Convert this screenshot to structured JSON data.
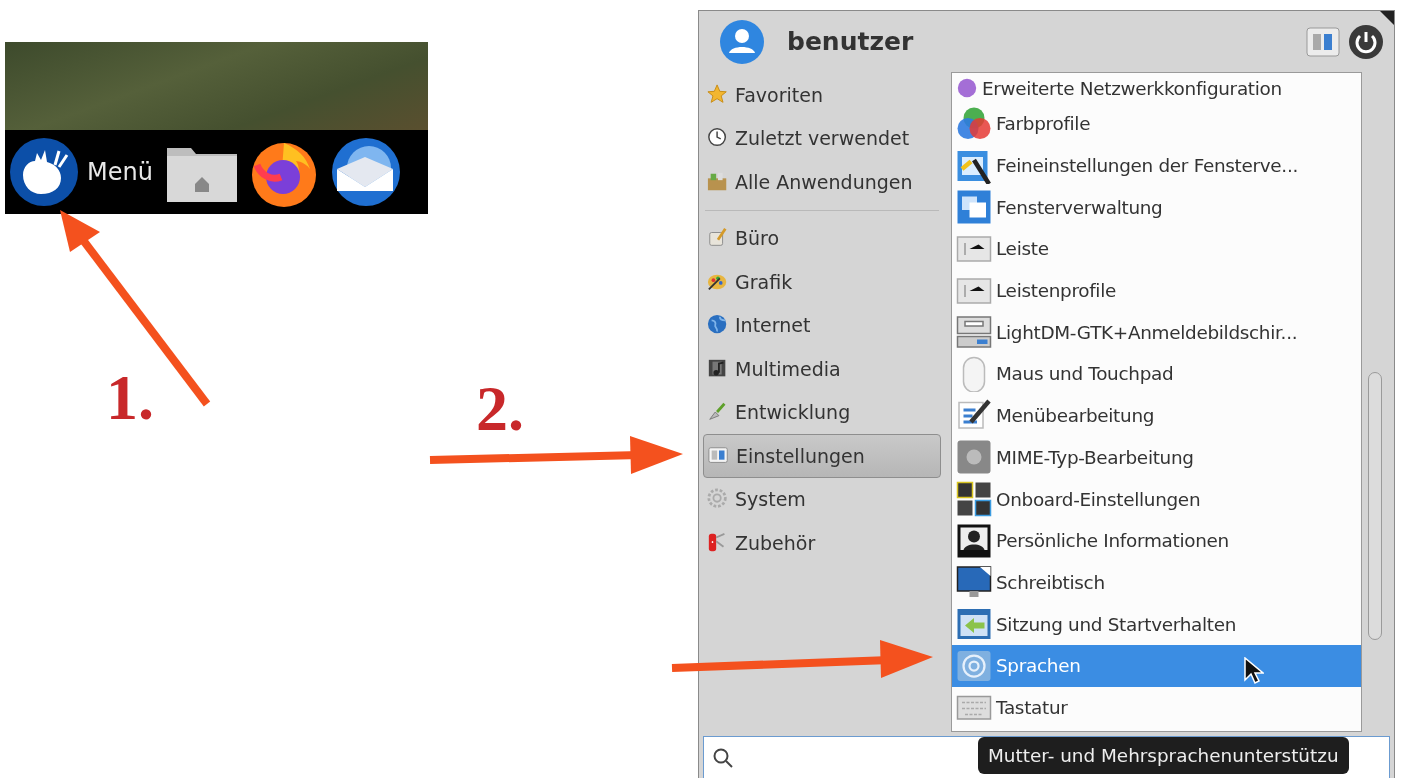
{
  "taskbar": {
    "menu_label": "Menü"
  },
  "annotations": {
    "steps": [
      "1.",
      "2."
    ]
  },
  "menu": {
    "user": "benutzer",
    "places": [
      {
        "label": "Favoriten"
      },
      {
        "label": "Zuletzt verwendet"
      },
      {
        "label": "Alle Anwendungen"
      }
    ],
    "categories": [
      {
        "label": "Büro",
        "selected": false
      },
      {
        "label": "Grafik",
        "selected": false
      },
      {
        "label": "Internet",
        "selected": false
      },
      {
        "label": "Multimedia",
        "selected": false
      },
      {
        "label": "Entwicklung",
        "selected": false
      },
      {
        "label": "Einstellungen",
        "selected": true
      },
      {
        "label": "System",
        "selected": false
      },
      {
        "label": "Zubehör",
        "selected": false
      }
    ],
    "apps": [
      {
        "label": "Erweiterte Netzwerkkonfiguration",
        "selected": false
      },
      {
        "label": "Farbprofile",
        "selected": false
      },
      {
        "label": "Feineinstellungen der Fensterve...",
        "selected": false
      },
      {
        "label": "Fensterverwaltung",
        "selected": false
      },
      {
        "label": "Leiste",
        "selected": false
      },
      {
        "label": "Leistenprofile",
        "selected": false
      },
      {
        "label": "LightDM-GTK+Anmeldebildschir...",
        "selected": false
      },
      {
        "label": "Maus und Touchpad",
        "selected": false
      },
      {
        "label": "Menübearbeitung",
        "selected": false
      },
      {
        "label": "MIME-Typ-Bearbeitung",
        "selected": false
      },
      {
        "label": "Onboard-Einstellungen",
        "selected": false
      },
      {
        "label": "Persönliche Informationen",
        "selected": false
      },
      {
        "label": "Schreibtisch",
        "selected": false
      },
      {
        "label": "Sitzung und Startverhalten",
        "selected": false
      },
      {
        "label": "Sprachen",
        "selected": true
      },
      {
        "label": "Tastatur",
        "selected": false
      }
    ],
    "tooltip": "Mutter- und Mehrsprachenunterstützu"
  }
}
